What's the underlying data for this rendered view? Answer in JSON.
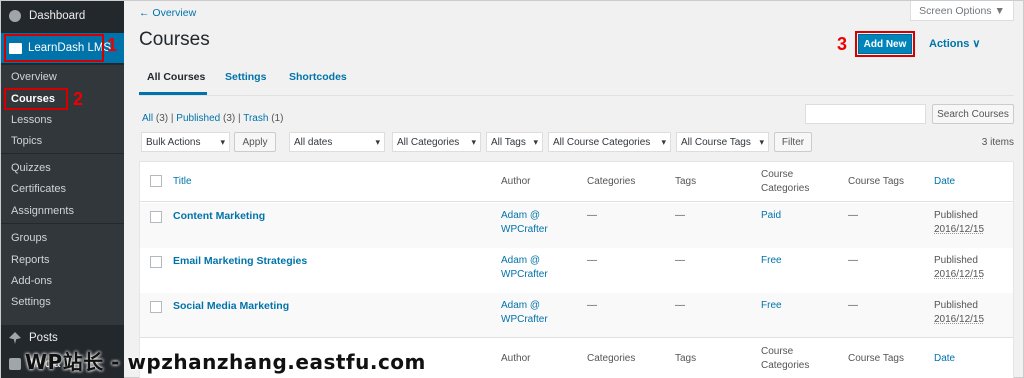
{
  "sidebar": {
    "dashboard": "Dashboard",
    "learndash": "LearnDash LMS",
    "items": [
      "Overview",
      "Courses",
      "Lessons",
      "Topics",
      "Quizzes",
      "Certificates",
      "Assignments",
      "Groups",
      "Reports",
      "Add-ons",
      "Settings"
    ],
    "posts": "Posts",
    "media": "Media"
  },
  "annotations": {
    "one": "1",
    "two": "2",
    "three": "3"
  },
  "header": {
    "overview_link": "← Overview",
    "screen_options": "Screen Options ▼",
    "title": "Courses",
    "add_new": "Add New",
    "actions": "Actions  ∨"
  },
  "tabs": [
    "All Courses",
    "Settings",
    "Shortcodes"
  ],
  "filters": {
    "all": "All",
    "all_count": "(3)",
    "published": "Published",
    "published_count": "(3)",
    "trash": "Trash",
    "trash_count": "(1)",
    "search_button": "Search Courses",
    "bulk_actions": "Bulk Actions",
    "apply": "Apply",
    "dates": "All dates",
    "categories": "All Categories",
    "tags": "All Tags",
    "course_categories": "All Course Categories",
    "course_tags": "All Course Tags",
    "filter": "Filter",
    "items_count": "3 items"
  },
  "table": {
    "headers": {
      "title": "Title",
      "author": "Author",
      "categories": "Categories",
      "tags": "Tags",
      "course_categories": "Course\nCategories",
      "course_tags": "Course Tags",
      "date": "Date"
    },
    "rows": [
      {
        "title": "Content Marketing",
        "author1": "Adam @",
        "author2": "WPCrafter",
        "categories": "—",
        "tags": "—",
        "course_category": "Paid",
        "course_tags": "—",
        "status": "Published",
        "date": "2016/12/15"
      },
      {
        "title": "Email Marketing Strategies",
        "author1": "Adam @",
        "author2": "WPCrafter",
        "categories": "—",
        "tags": "—",
        "course_category": "Free",
        "course_tags": "—",
        "status": "Published",
        "date": "2016/12/15"
      },
      {
        "title": "Social Media Marketing",
        "author1": "Adam @",
        "author2": "WPCrafter",
        "categories": "—",
        "tags": "—",
        "course_category": "Free",
        "course_tags": "—",
        "status": "Published",
        "date": "2016/12/15"
      }
    ],
    "footer": {
      "author": "Author",
      "categories": "Categories",
      "tags": "Tags",
      "course_categories": "Course\nCategories",
      "course_tags": "Course Tags",
      "date": "Date"
    }
  },
  "watermark": "WP站长 - wpzhanzhang.eastfu.com",
  "colors": {
    "accent": "#0073aa",
    "sidebar": "#23282d",
    "highlight": "#d40000"
  }
}
